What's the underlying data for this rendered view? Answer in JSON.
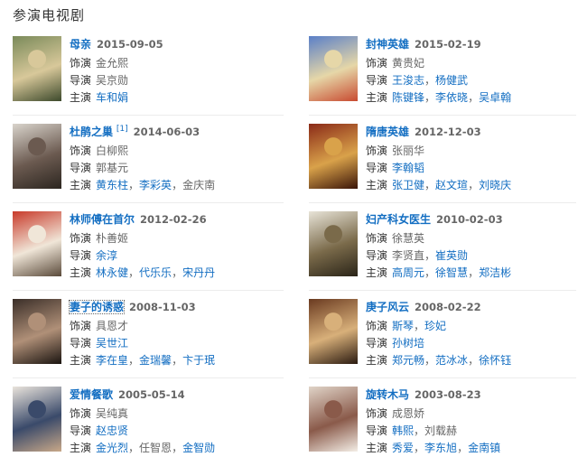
{
  "section_title": "参演电视剧",
  "labels": {
    "role": "饰演",
    "director": "导演",
    "cast": "主演"
  },
  "items": [
    {
      "title": "母亲",
      "sup": "",
      "date": "2015-09-05",
      "role": "金允熙",
      "directors": [
        {
          "name": "吴京勋",
          "link": false
        }
      ],
      "cast": [
        {
          "name": "车和娟",
          "link": true
        }
      ],
      "colors": [
        "#7a8a5a",
        "#d8c89a",
        "#3d4a2c"
      ]
    },
    {
      "title": "封神英雄",
      "sup": "",
      "date": "2015-02-19",
      "role": "黄贵妃",
      "directors": [
        {
          "name": "王浚志",
          "link": true
        },
        {
          "name": "杨健武",
          "link": true
        }
      ],
      "cast": [
        {
          "name": "陈键锋",
          "link": true
        },
        {
          "name": "李依晓",
          "link": true
        },
        {
          "name": "吴卓翰",
          "link": true
        }
      ],
      "colors": [
        "#5a7fc8",
        "#e6d7a8",
        "#c84a30"
      ]
    },
    {
      "title": "杜鹃之巢",
      "sup": "[1]",
      "date": "2014-06-03",
      "role": "白柳熙",
      "directors": [
        {
          "name": "郭基元",
          "link": false
        }
      ],
      "cast": [
        {
          "name": "黄东柱",
          "link": true
        },
        {
          "name": "李彩英",
          "link": true
        },
        {
          "name": "金庆南",
          "link": false
        }
      ],
      "colors": [
        "#d9d4cc",
        "#6b5a50",
        "#2c2620"
      ]
    },
    {
      "title": "隋唐英雄",
      "sup": "",
      "date": "2012-12-03",
      "role": "张丽华",
      "directors": [
        {
          "name": "李翰韬",
          "link": true
        }
      ],
      "cast": [
        {
          "name": "张卫健",
          "link": true
        },
        {
          "name": "赵文瑄",
          "link": true
        },
        {
          "name": "刘晓庆",
          "link": true
        }
      ],
      "colors": [
        "#8a2a18",
        "#d9a24a",
        "#3a1408"
      ]
    },
    {
      "title": "林师傅在首尔",
      "sup": "",
      "date": "2012-02-26",
      "role": "朴善姬",
      "directors": [
        {
          "name": "余淳",
          "link": true
        }
      ],
      "cast": [
        {
          "name": "林永健",
          "link": true
        },
        {
          "name": "代乐乐",
          "link": true
        },
        {
          "name": "宋丹丹",
          "link": true
        }
      ],
      "colors": [
        "#c83a2a",
        "#f0e6d8",
        "#5a4a3a"
      ]
    },
    {
      "title": "妇产科女医生",
      "sup": "",
      "date": "2010-02-03",
      "role": "徐慧英",
      "directors": [
        {
          "name": "李贤直",
          "link": false
        },
        {
          "name": "崔英勋",
          "link": true
        }
      ],
      "cast": [
        {
          "name": "高周元",
          "link": true
        },
        {
          "name": "徐智慧",
          "link": true
        },
        {
          "name": "郑洁彬",
          "link": true
        }
      ],
      "colors": [
        "#e8e4d8",
        "#7a6a4a",
        "#2a2418"
      ]
    },
    {
      "title": "妻子的诱惑",
      "sup": "",
      "date": "2008-11-03",
      "role": "具恩才",
      "directors": [
        {
          "name": "吴世江",
          "link": true
        }
      ],
      "cast": [
        {
          "name": "李在皇",
          "link": true
        },
        {
          "name": "金瑞馨",
          "link": true
        },
        {
          "name": "卞于珉",
          "link": true
        }
      ],
      "colors": [
        "#3a2e28",
        "#b09078",
        "#1a1410"
      ],
      "boxed": true
    },
    {
      "title": "庚子风云",
      "sup": "",
      "date": "2008-02-22",
      "role": "斯琴",
      "role_link": true,
      "role_extra": "珍妃",
      "directors": [
        {
          "name": "孙树培",
          "link": true
        }
      ],
      "cast": [
        {
          "name": "郑元畅",
          "link": true
        },
        {
          "name": "范冰冰",
          "link": true
        },
        {
          "name": "徐怀钰",
          "link": true
        }
      ],
      "colors": [
        "#6a3a20",
        "#d8b07a",
        "#2a1a10"
      ]
    },
    {
      "title": "爱情餐歌",
      "sup": "",
      "date": "2005-05-14",
      "role": "吴纯真",
      "directors": [
        {
          "name": "赵忠贤",
          "link": true
        }
      ],
      "cast": [
        {
          "name": "金光烈",
          "link": true
        },
        {
          "name": "任智恩",
          "link": false
        },
        {
          "name": "金智勋",
          "link": true
        }
      ],
      "colors": [
        "#eae4dc",
        "#3a4a6a",
        "#c8a888"
      ]
    },
    {
      "title": "旋转木马",
      "sup": "",
      "date": "2003-08-23",
      "role": "成恩娇",
      "directors": [
        {
          "name": "韩熙",
          "link": true
        },
        {
          "name": "刘载赫",
          "link": false
        }
      ],
      "cast": [
        {
          "name": "秀爱",
          "link": true
        },
        {
          "name": "李东旭",
          "link": true
        },
        {
          "name": "金南镇",
          "link": true
        }
      ],
      "colors": [
        "#e0d4c8",
        "#8a5a4a",
        "#f4eee6"
      ]
    }
  ]
}
